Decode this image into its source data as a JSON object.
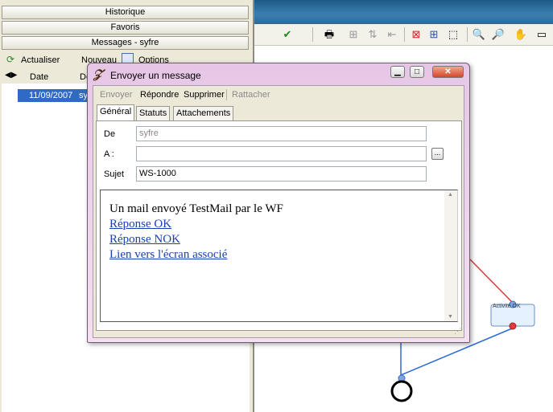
{
  "left_panel": {
    "accordion": [
      "Historique",
      "Favoris",
      "Messages - syfre"
    ],
    "toolbar": {
      "refresh": "Actualiser",
      "new": "Nouveau",
      "options": "Options"
    },
    "columns": {
      "date": "Date",
      "de": "De"
    },
    "rows": [
      {
        "date": "11/09/2007",
        "from": "sy"
      }
    ]
  },
  "dialog": {
    "title": "Envoyer un message",
    "menu": {
      "send": "Envoyer",
      "reply": "Répondre",
      "delete": "Supprimer",
      "attach": "Rattacher"
    },
    "tabs": [
      "Général",
      "Statuts",
      "Attachements"
    ],
    "fields": {
      "from_label": "De",
      "from_value": "syfre",
      "to_label": "A :",
      "to_value": "",
      "subject_label": "Sujet",
      "subject_value": "WS-1000",
      "browse": "..."
    },
    "body": {
      "line1": "Un mail envoyé TestMail par le WF",
      "link1": "Réponse OK",
      "link2": "Réponse NOK",
      "link3": "Lien vers l'écran associé"
    }
  },
  "canvas": {
    "node_label": "Activité OK"
  }
}
